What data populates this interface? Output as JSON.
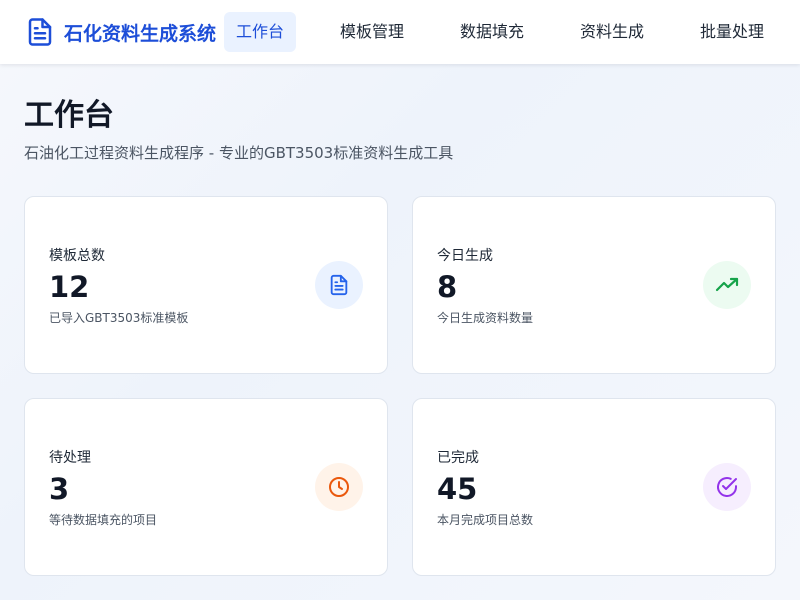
{
  "app": {
    "title": "石化资料生成系统",
    "logo_icon": "document-icon",
    "brand_color": "#1d4ed8"
  },
  "nav": {
    "items": [
      {
        "label": "工作台",
        "active": true
      },
      {
        "label": "模板管理",
        "active": false
      },
      {
        "label": "数据填充",
        "active": false
      },
      {
        "label": "资料生成",
        "active": false
      },
      {
        "label": "批量处理",
        "active": false
      }
    ]
  },
  "page": {
    "title": "工作台",
    "subtitle": "石油化工过程资料生成程序 - 专业的GBT3503标准资料生成工具"
  },
  "stats": [
    {
      "label": "模板总数",
      "value": "12",
      "desc": "已导入GBT3503标准模板",
      "icon": "document-icon",
      "color": "#2563eb",
      "bg": "#eaf2ff"
    },
    {
      "label": "今日生成",
      "value": "8",
      "desc": "今日生成资料数量",
      "icon": "trending-up-icon",
      "color": "#16a34a",
      "bg": "#ecfbf1"
    },
    {
      "label": "待处理",
      "value": "3",
      "desc": "等待数据填充的项目",
      "icon": "clock-icon",
      "color": "#ea580c",
      "bg": "#fff3e9"
    },
    {
      "label": "已完成",
      "value": "45",
      "desc": "本月完成项目总数",
      "icon": "check-circle-icon",
      "color": "#9333ea",
      "bg": "#f6eefe"
    }
  ]
}
